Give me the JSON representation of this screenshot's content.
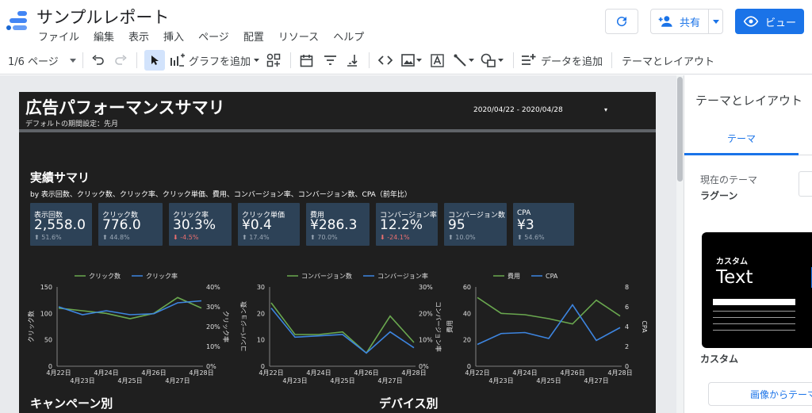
{
  "header": {
    "title": "サンプルレポート",
    "menus": [
      "ファイル",
      "編集",
      "表示",
      "挿入",
      "ページ",
      "配置",
      "リソース",
      "ヘルプ"
    ],
    "share_label": "共有",
    "view_label": "ビュー"
  },
  "toolbar": {
    "page_label": "1/6 ページ",
    "add_chart_label": "グラフを追加",
    "add_data_label": "データを追加",
    "theme_layout_label": "テーマとレイアウト"
  },
  "report": {
    "title": "広告パフォーマンスサマリ",
    "subtitle": "デフォルトの期間設定：先月",
    "date_range": "2020/04/22 - 2020/04/28",
    "date_dropdown": "▾",
    "section1_title": "実績サマリ",
    "section1_sub": "by 表示回数、クリック数、クリック率、クリック単価、費用、コンバージョン率、コンバージョン数、CPA（前年比）",
    "section2_title": "キャンペーン別",
    "section3_title": "デバイス別",
    "kpis": [
      {
        "label": "表示回数",
        "value": "2,558.0",
        "delta": "⬆ 51.6%",
        "dir": "up"
      },
      {
        "label": "クリック数",
        "value": "776.0",
        "delta": "⬆ 44.8%",
        "dir": "up"
      },
      {
        "label": "クリック率",
        "value": "30.3%",
        "delta": "⬇ -4.5%",
        "dir": "down"
      },
      {
        "label": "クリック単価",
        "value": "¥0.4",
        "delta": "⬆ 17.4%",
        "dir": "up"
      },
      {
        "label": "費用",
        "value": "¥286.3",
        "delta": "⬆ 70.0%",
        "dir": "up"
      },
      {
        "label": "コンバージョン率",
        "value": "12.2%",
        "delta": "⬇ -24.1%",
        "dir": "down"
      },
      {
        "label": "コンバージョン数",
        "value": "95",
        "delta": "⬆ 10.0%",
        "dir": "up"
      },
      {
        "label": "CPA",
        "value": "¥3",
        "delta": "⬆ 54.6%",
        "dir": "up"
      }
    ]
  },
  "colors": {
    "green": "#6aa84f",
    "blue": "#3d85e0",
    "axis": "#9e9e9e",
    "accent": "#1a73e8"
  },
  "chart_data": [
    {
      "type": "line",
      "x": [
        "4月22日",
        "4月23日",
        "4月24日",
        "4月25日",
        "4月26日",
        "4月27日",
        "4月28日"
      ],
      "series": [
        {
          "name": "クリック数",
          "axis": "left",
          "color": "#6aa84f",
          "values": [
            110,
            105,
            100,
            90,
            100,
            130,
            110
          ]
        },
        {
          "name": "クリック率",
          "axis": "right",
          "color": "#3d85e0",
          "values": [
            30,
            26,
            28,
            26,
            26.5,
            32,
            33
          ]
        }
      ],
      "ylabel": "クリック数",
      "y2label": "クリック率",
      "ylim": [
        0,
        150
      ],
      "yticks": [
        "0",
        "50",
        "100",
        "150"
      ],
      "y2lim": [
        0,
        40
      ],
      "y2ticks": [
        "0%",
        "10%",
        "20%",
        "30%",
        "40%"
      ]
    },
    {
      "type": "line",
      "x": [
        "4月22日",
        "4月23日",
        "4月24日",
        "4月25日",
        "4月26日",
        "4月27日",
        "4月28日"
      ],
      "series": [
        {
          "name": "コンバージョン数",
          "axis": "left",
          "color": "#6aa84f",
          "values": [
            24,
            12,
            12,
            13,
            5,
            19,
            9
          ]
        },
        {
          "name": "コンバージョン率",
          "axis": "right",
          "color": "#3d85e0",
          "values": [
            22,
            11,
            11.5,
            12,
            5,
            13,
            7
          ]
        }
      ],
      "ylabel": "コンバージョン数",
      "y2label": "コンバージョン率",
      "ylim": [
        0,
        30
      ],
      "yticks": [
        "0",
        "10",
        "20",
        "30"
      ],
      "y2lim": [
        0,
        30
      ],
      "y2ticks": [
        "0%",
        "10%",
        "20%",
        "30%"
      ]
    },
    {
      "type": "line",
      "x": [
        "4月22日",
        "4月23日",
        "4月24日",
        "4月25日",
        "4月26日",
        "4月27日",
        "4月28日"
      ],
      "series": [
        {
          "name": "費用",
          "axis": "left",
          "color": "#6aa84f",
          "values": [
            52,
            40,
            39,
            36,
            32,
            50,
            38
          ]
        },
        {
          "name": "CPA",
          "axis": "right",
          "color": "#3d85e0",
          "values": [
            2.2,
            3.3,
            3.4,
            2.8,
            6.2,
            2.6,
            3.9
          ]
        }
      ],
      "ylabel": "費用",
      "y2label": "CPA",
      "ylim": [
        0,
        60
      ],
      "yticks": [
        "0",
        "20",
        "40",
        "60"
      ],
      "y2lim": [
        0,
        8
      ],
      "y2ticks": [
        "0",
        "2",
        "4",
        "6",
        "8"
      ]
    }
  ],
  "panel": {
    "title": "テーマとレイアウト",
    "tab_theme": "テーマ",
    "current_theme_label": "現在のテーマ",
    "current_theme_value": "ラグーン",
    "card_heading": "カスタム",
    "card_big_text": "Text",
    "card_name": "カスタム",
    "from_image_label": "画像からテーマ"
  }
}
